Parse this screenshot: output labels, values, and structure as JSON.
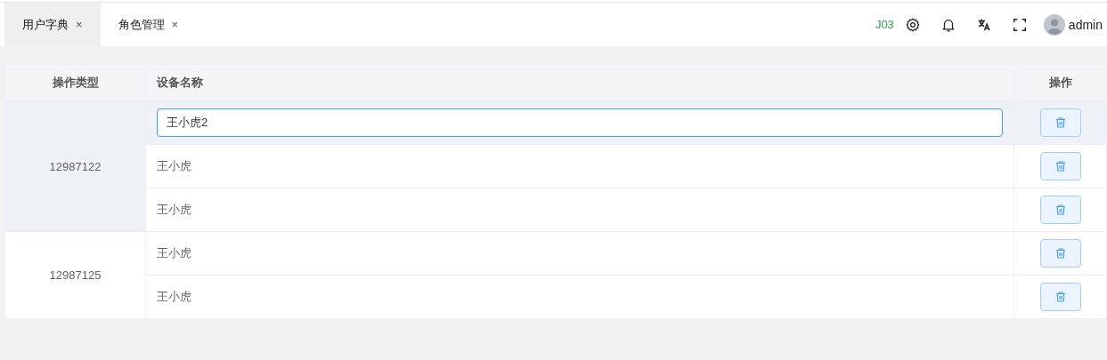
{
  "tabs": [
    {
      "label": "用户字典",
      "close": "×",
      "selected": true
    },
    {
      "label": "角色管理",
      "close": "×",
      "selected": false
    }
  ],
  "header": {
    "code": "J03",
    "user": "admin"
  },
  "table": {
    "columns": [
      "操作类型",
      "设备名称",
      "操作"
    ],
    "groups": [
      {
        "type": "12987122",
        "rows": [
          {
            "name": "王小虎2",
            "editing": true,
            "hovered": true
          },
          {
            "name": "王小虎",
            "editing": false,
            "hovered": false
          },
          {
            "name": "王小虎",
            "editing": false,
            "hovered": false
          }
        ]
      },
      {
        "type": "12987125",
        "rows": [
          {
            "name": "王小虎",
            "editing": false,
            "hovered": false
          },
          {
            "name": "王小虎",
            "editing": false,
            "hovered": false
          }
        ]
      }
    ]
  }
}
